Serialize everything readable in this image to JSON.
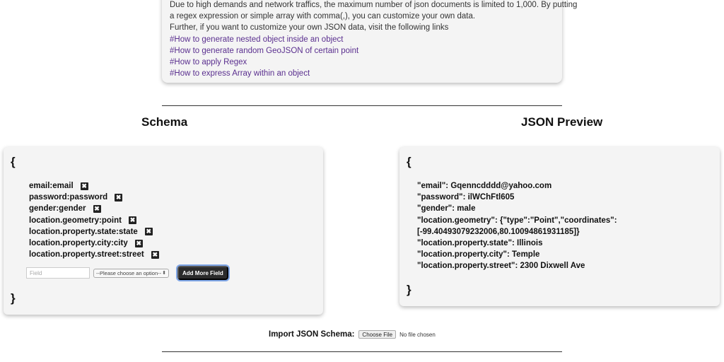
{
  "info": {
    "lines": [
      "Due to high demands and network traffics, the maximum number of json documents is limited to 1,000. By putting",
      "a regex expression or simple array with comma(,), you can customize your own data.",
      "Further, if you want to customize your own JSON data, visit the following links"
    ],
    "links": [
      "#How to generate nested object inside an object",
      "#How to generate random GeoJSON of certain point",
      "#How to apply Regex",
      "#How to express Array within an object"
    ]
  },
  "schema": {
    "title": "Schema",
    "open_brace": "{",
    "close_brace": "}",
    "fields": [
      "email:email",
      "password:password",
      "gender:gender",
      "location.geometry:point",
      "location.property.state:state",
      "location.property.city:city",
      "location.property.street:street"
    ],
    "delete_glyph": "✖",
    "field_placeholder": "Field",
    "type_select_label": "--Please choose an option--",
    "add_button_label": "Add More Field"
  },
  "preview": {
    "title": "JSON Preview",
    "open_brace": "{",
    "close_brace": "}",
    "lines": [
      "\"email\": Gqenncdddd@yahoo.com",
      "\"password\": ilWChFtl605",
      "\"gender\": male",
      "\"location.geometry\": {\"type\":\"Point\",\"coordinates\":",
      "[-99.40493079232006,80.10094861931185]}",
      "\"location.property.state\": Illinois",
      "\"location.property.city\": Temple",
      "\"location.property.street\": 2300 Dixwell Ave"
    ]
  },
  "import": {
    "label": "Import JSON Schema:",
    "button_label": "Choose File",
    "status": "No file chosen"
  },
  "colors": {
    "link": "#5a2f8f",
    "panel_bg": "#f4f4f4",
    "button_bg": "#2b2b2b",
    "button_focus": "#7fa6e6"
  }
}
